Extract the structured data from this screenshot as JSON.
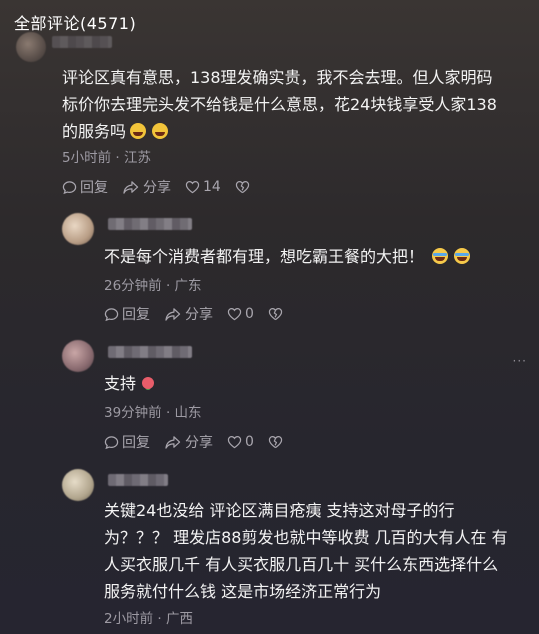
{
  "header": {
    "title": "全部评论(4571)"
  },
  "comments": [
    {
      "lines": [
        "评论区真有意思，138理发确实贵，我不会去理。但人家明码",
        "标价你去理完头发不给钱是什么意思，花24块钱享受人家138",
        "的服务吗"
      ],
      "time_location": "5小时前 · 江苏",
      "reply": "回复",
      "share": "分享",
      "likes": "14",
      "emoji": [
        "grin-sweat-icon",
        "grin-sweat-icon"
      ]
    },
    {
      "lines": [
        "不是每个消费者都有理，想吃霸王餐的大把！"
      ],
      "time_location": "26分钟前 · 广东",
      "reply": "回复",
      "share": "分享",
      "likes": "0",
      "emoji": [
        "laugh-cry-icon",
        "laugh-cry-icon"
      ]
    },
    {
      "lines": [
        "支持"
      ],
      "time_location": "39分钟前 · 山东",
      "reply": "回复",
      "share": "分享",
      "likes": "0",
      "emoji": [
        "rose-icon"
      ]
    },
    {
      "lines": [
        "关键24也没给 评论区满目疮痍 支持这对母子的行",
        "为？？？ 理发店88剪发也就中等收费 几百的大有人在 有",
        "人买衣服几千 有人买衣服几百几十 买什么东西选择什么",
        "服务就付什么钱 这是市场经济正常行为"
      ],
      "time_location": "2小时前 · 广西"
    }
  ],
  "more_label": "···"
}
